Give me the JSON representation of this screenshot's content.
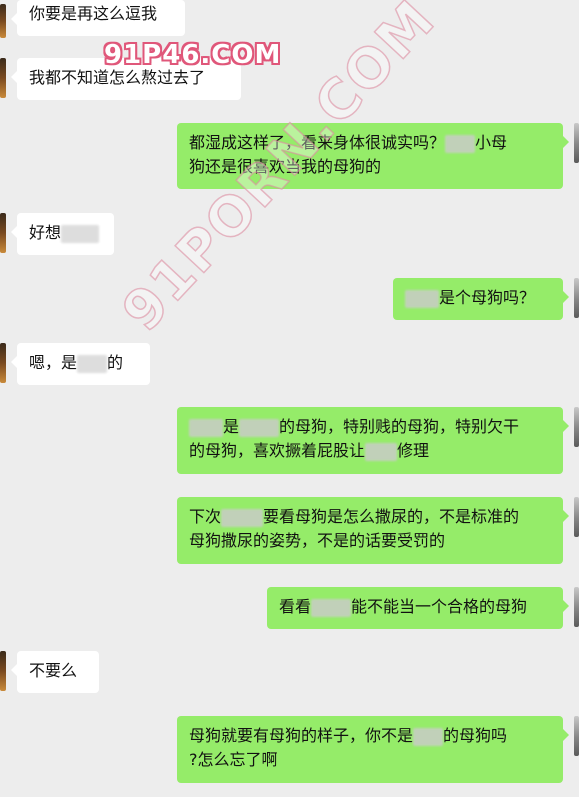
{
  "watermark": {
    "top": "91P46.COM",
    "diagonal": "91PORN.COM"
  },
  "messages": [
    {
      "side": "in",
      "parts": [
        "你要是再这么逗我"
      ]
    },
    {
      "side": "in",
      "parts": [
        "我都不知道怎么熬过去了"
      ]
    },
    {
      "side": "out",
      "line1": [
        "都湿成这样了，看来身体很诚实吗？",
        "",
        "小母"
      ],
      "line2": [
        "狗还是很喜欢当我的母狗的"
      ]
    },
    {
      "side": "in",
      "parts": [
        "好想",
        ""
      ]
    },
    {
      "side": "out",
      "parts": [
        "",
        "是个母狗吗？"
      ]
    },
    {
      "side": "in",
      "parts": [
        "嗯，是",
        "的"
      ]
    },
    {
      "side": "out",
      "line1": [
        "",
        "是",
        "的母狗，特别贱的母狗，特别欠干"
      ],
      "line2": [
        "的母狗，喜欢撅着屁股让",
        "修理"
      ]
    },
    {
      "side": "out",
      "line1": [
        "下次",
        "要看母狗是怎么撒尿的，不是标准的"
      ],
      "line2": [
        "母狗撒尿的姿势，不是的话要受罚的"
      ]
    },
    {
      "side": "out",
      "parts": [
        "看看",
        "能不能当一个合格的母狗"
      ]
    },
    {
      "side": "in",
      "parts": [
        "不要么"
      ]
    },
    {
      "side": "out",
      "line1": [
        "母狗就要有母狗的样子，你不是",
        "的母狗吗"
      ],
      "line2": [
        "?怎么忘了啊"
      ]
    }
  ]
}
